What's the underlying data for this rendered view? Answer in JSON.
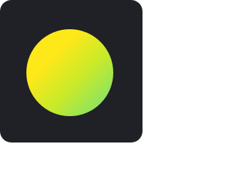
{
  "app_icon": {
    "name": "app-logo",
    "icon": "gradient-circle-icon",
    "colors": {
      "background": "#1f2126",
      "gradient_start": "#ffe81a",
      "gradient_mid": "#c8ea2a",
      "gradient_end": "#6fe07b"
    }
  }
}
